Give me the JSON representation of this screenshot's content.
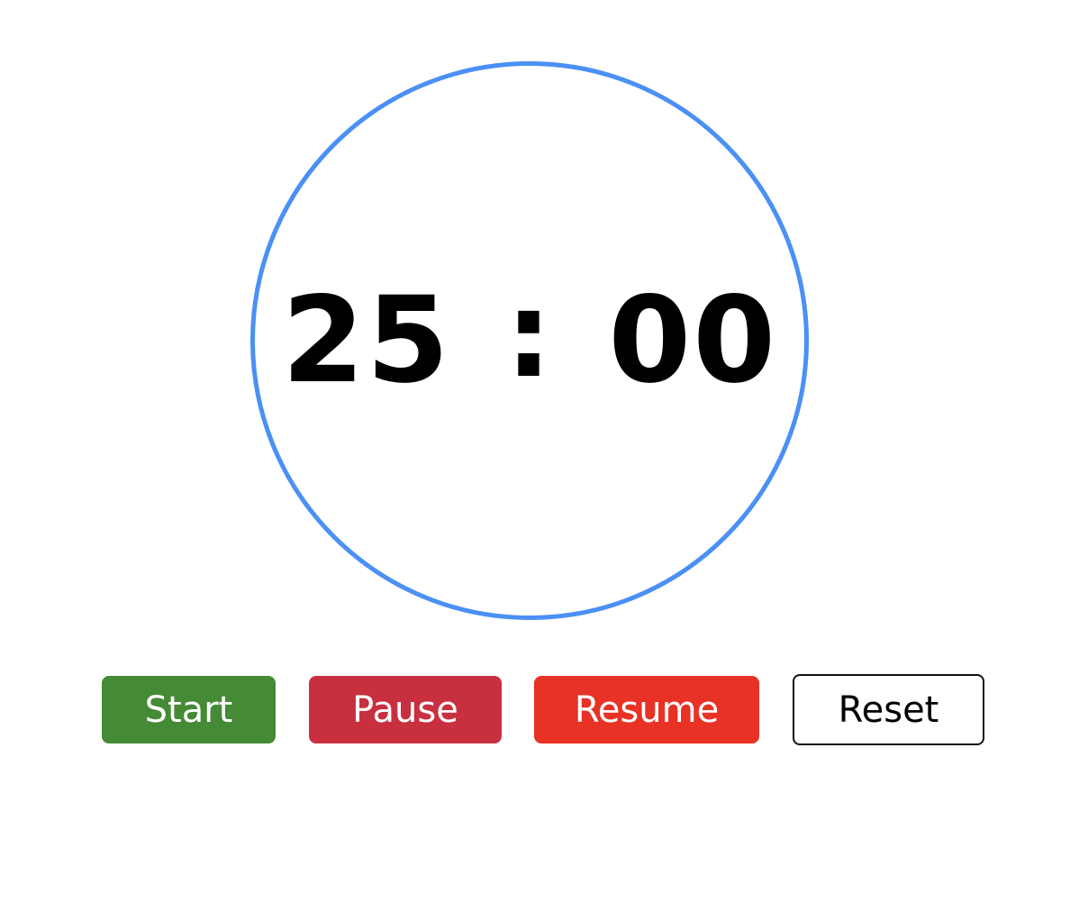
{
  "timer": {
    "minutes": "25",
    "separator": ":",
    "seconds": "00",
    "ring_color": "#4a90f5"
  },
  "controls": {
    "start_label": "Start",
    "pause_label": "Pause",
    "resume_label": "Resume",
    "reset_label": "Reset",
    "start_color": "#458a35",
    "pause_color": "#c83040",
    "resume_color": "#e83226"
  }
}
